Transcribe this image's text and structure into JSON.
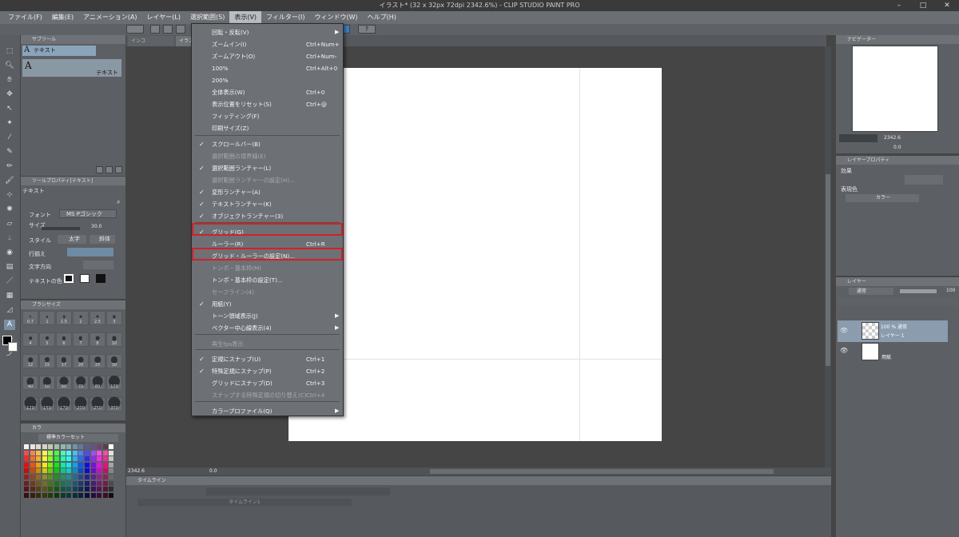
{
  "window": {
    "title": "イラスト* (32 x 32px 72dpi 2342.6%) - CLIP STUDIO PAINT PRO"
  },
  "menubar": {
    "items": [
      "ファイル(F)",
      "編集(E)",
      "アニメーション(A)",
      "レイヤー(L)",
      "選択範囲(S)",
      "表示(V)",
      "フィルター(I)",
      "ウィンドウ(W)",
      "ヘルプ(H)"
    ],
    "active_index": 5
  },
  "canvas_tabs": [
    "インコ",
    "イラスト"
  ],
  "view_menu": {
    "items": [
      {
        "label": "回転・反転(V)",
        "shortcut": "",
        "checked": false,
        "disabled": false,
        "submenu": true
      },
      {
        "label": "ズームイン(I)",
        "shortcut": "Ctrl+Num+",
        "checked": false,
        "disabled": false,
        "submenu": false
      },
      {
        "label": "ズームアウト(O)",
        "shortcut": "Ctrl+Num-",
        "checked": false,
        "disabled": false,
        "submenu": false
      },
      {
        "label": "100%",
        "shortcut": "Ctrl+Alt+0",
        "checked": false,
        "disabled": false,
        "submenu": false
      },
      {
        "label": "200%",
        "shortcut": "",
        "checked": false,
        "disabled": false,
        "submenu": false
      },
      {
        "label": "全体表示(W)",
        "shortcut": "Ctrl+0",
        "checked": false,
        "disabled": false,
        "submenu": false
      },
      {
        "label": "表示位置をリセット(S)",
        "shortcut": "Ctrl+@",
        "checked": false,
        "disabled": false,
        "submenu": false
      },
      {
        "label": "フィッティング(F)",
        "shortcut": "",
        "checked": false,
        "disabled": false,
        "submenu": false
      },
      {
        "label": "印刷サイズ(Z)",
        "shortcut": "",
        "checked": false,
        "disabled": false,
        "submenu": false
      },
      {
        "label": "スクロールバー(B)",
        "shortcut": "",
        "checked": true,
        "disabled": false,
        "submenu": false
      },
      {
        "label": "選択範囲の境界線(E)",
        "shortcut": "",
        "checked": false,
        "disabled": true,
        "submenu": false
      },
      {
        "label": "選択範囲ランチャー(L)",
        "shortcut": "",
        "checked": true,
        "disabled": false,
        "submenu": false
      },
      {
        "label": "選択範囲ランチャーの設定(H)...",
        "shortcut": "",
        "checked": false,
        "disabled": true,
        "submenu": false
      },
      {
        "label": "変形ランチャー(A)",
        "shortcut": "",
        "checked": true,
        "disabled": false,
        "submenu": false
      },
      {
        "label": "テキストランチャー(K)",
        "shortcut": "",
        "checked": true,
        "disabled": false,
        "submenu": false
      },
      {
        "label": "オブジェクトランチャー(3)",
        "shortcut": "",
        "checked": true,
        "disabled": false,
        "submenu": false
      },
      {
        "label": "グリッド(G)",
        "shortcut": "",
        "checked": true,
        "disabled": false,
        "submenu": false
      },
      {
        "label": "ルーラー(R)",
        "shortcut": "Ctrl+R",
        "checked": false,
        "disabled": false,
        "submenu": false
      },
      {
        "label": "グリッド・ルーラーの設定(N)...",
        "shortcut": "",
        "checked": false,
        "disabled": false,
        "submenu": false
      },
      {
        "label": "トンボ・基本枠(M)",
        "shortcut": "",
        "checked": false,
        "disabled": true,
        "submenu": false
      },
      {
        "label": "トンボ・基本枠の設定(T)...",
        "shortcut": "",
        "checked": false,
        "disabled": false,
        "submenu": false
      },
      {
        "label": "セーフライン(4)",
        "shortcut": "",
        "checked": false,
        "disabled": true,
        "submenu": false
      },
      {
        "label": "用紙(Y)",
        "shortcut": "",
        "checked": true,
        "disabled": false,
        "submenu": false
      },
      {
        "label": "トーン領域表示(J)",
        "shortcut": "",
        "checked": false,
        "disabled": false,
        "submenu": true
      },
      {
        "label": "ベクター中心線表示(4)",
        "shortcut": "",
        "checked": false,
        "disabled": false,
        "submenu": true
      },
      {
        "label": "再生fps表示",
        "shortcut": "",
        "checked": false,
        "disabled": true,
        "submenu": false
      },
      {
        "label": "定規にスナップ(U)",
        "shortcut": "Ctrl+1",
        "checked": true,
        "disabled": false,
        "submenu": false
      },
      {
        "label": "特殊定規にスナップ(P)",
        "shortcut": "Ctrl+2",
        "checked": true,
        "disabled": false,
        "submenu": false
      },
      {
        "label": "グリッドにスナップ(D)",
        "shortcut": "Ctrl+3",
        "checked": false,
        "disabled": false,
        "submenu": false
      },
      {
        "label": "スナップする特殊定規の切り替え(C)",
        "shortcut": "Ctrl+4",
        "checked": false,
        "disabled": true,
        "submenu": false
      },
      {
        "label": "カラープロファイル(Q)",
        "shortcut": "",
        "checked": false,
        "disabled": false,
        "submenu": true
      }
    ]
  },
  "subtool": {
    "header": "サブツール",
    "tab": "テキスト",
    "item": "テキスト"
  },
  "tool_property": {
    "header": "ツールプロパティ[テキスト]",
    "title": "テキスト",
    "font_label": "フォント",
    "font_value": "MS Pゴシック",
    "size_label": "サイズ",
    "size_value": "30.0",
    "style_label": "スタイル",
    "bold": "太字",
    "italic": "斜体",
    "align_label": "行揃え",
    "direction_label": "文字方向",
    "color_label": "テキストの色"
  },
  "brush_size": {
    "header": "ブラシサイズ",
    "sizes": [
      "0.7",
      "1",
      "1.5",
      "2",
      "2.5",
      "3",
      "4",
      "5",
      "6",
      "7",
      "8",
      "10",
      "12",
      "15",
      "17",
      "20",
      "25",
      "30",
      "40",
      "50",
      "60",
      "70",
      "80",
      "100",
      "120",
      "150",
      "170",
      "200",
      "250",
      "300"
    ]
  },
  "color_set": {
    "tab": "カラ",
    "name": "標準カラーセット"
  },
  "navigator": {
    "header": "ナビゲーター",
    "zoom": "2342.6",
    "rotation": "0.0"
  },
  "layer_property": {
    "header": "レイヤープロパティ",
    "effect_label": "効果",
    "display_color_label": "表現色",
    "display_color_value": "カラー"
  },
  "layers": {
    "header": "レイヤー",
    "blend_mode": "通常",
    "opacity": "100",
    "items": [
      {
        "info": "100 % 通常",
        "name": "レイヤー 1"
      },
      {
        "info": "",
        "name": "用紙"
      }
    ]
  },
  "status": {
    "zoom": "2342.6",
    "angle": "0.0"
  },
  "timeline": {
    "header": "タイムライン",
    "track": "タイムライン1"
  }
}
